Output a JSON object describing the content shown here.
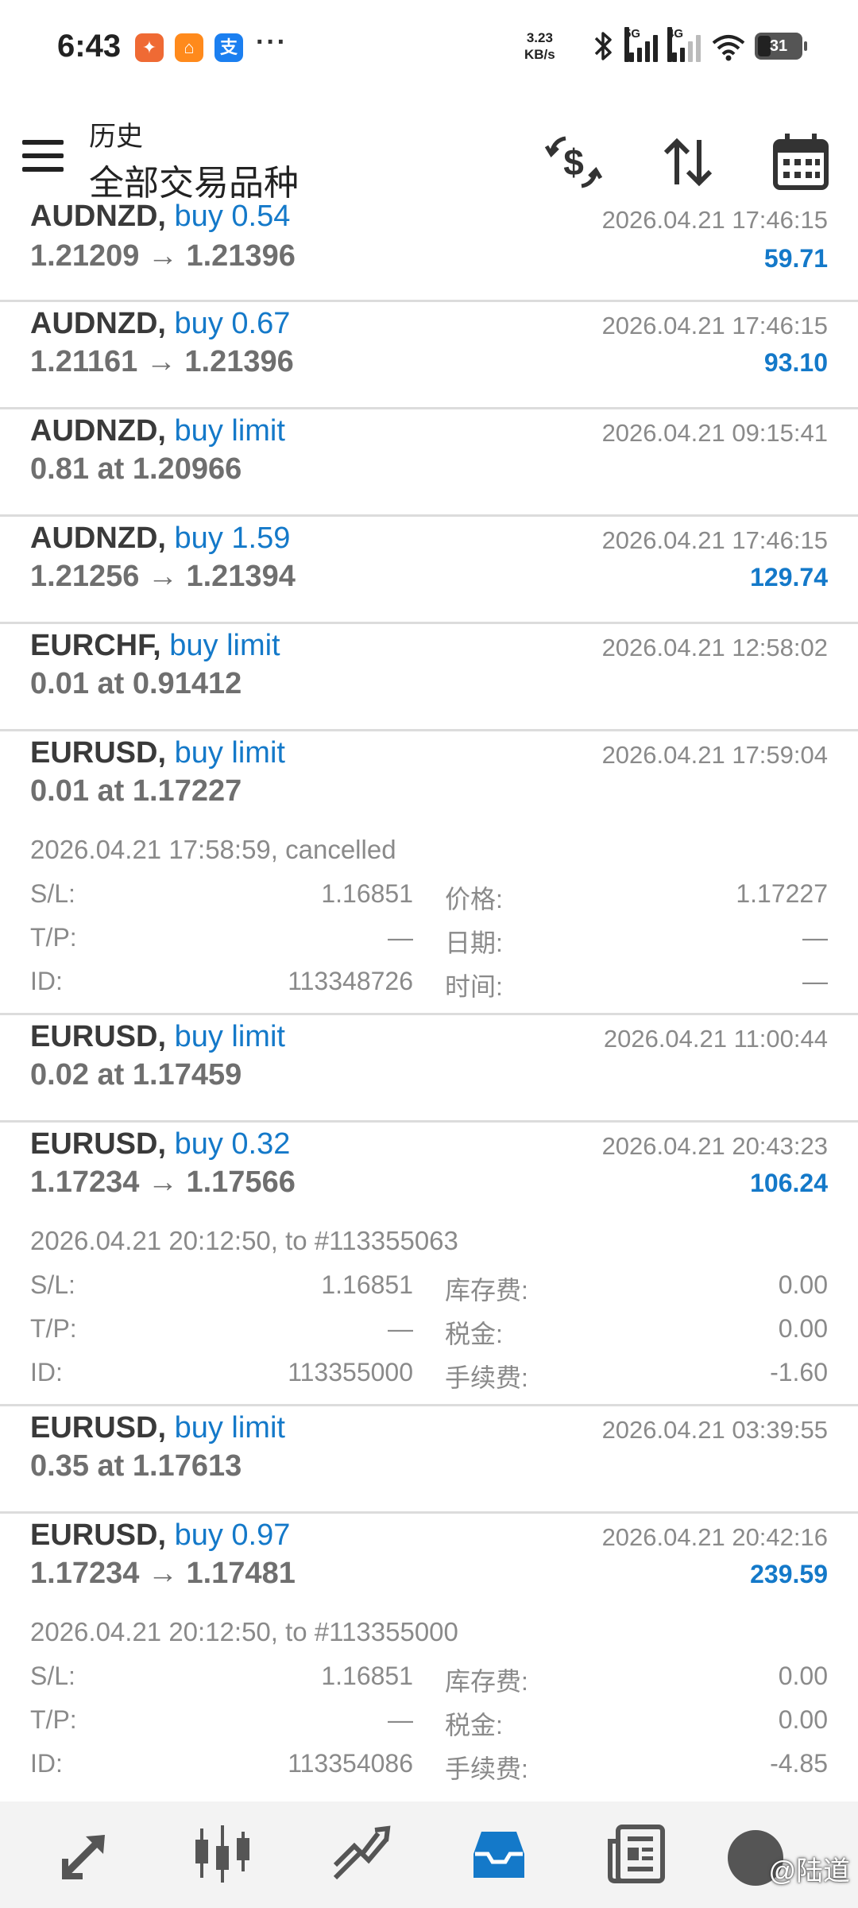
{
  "status_bar": {
    "time": "6:43",
    "dots": "···",
    "net_speed_value": "3.23",
    "net_speed_unit": "KB/s",
    "signal1_label": "5G",
    "signal2_label": "4G",
    "battery": "31"
  },
  "header": {
    "subtitle": "历史",
    "title": "全部交易品种"
  },
  "labels": {
    "sl": "S/L:",
    "tp": "T/P:",
    "id": "ID:",
    "price": "价格:",
    "date": "日期:",
    "time": "时间:",
    "swap": "库存费:",
    "tax": "税金:",
    "commission": "手续费:"
  },
  "records": [
    {
      "symbol": "AUDNZD,",
      "action": "buy 0.54",
      "line2": "1.21209 → 1.21396",
      "time": "2026.04.21 17:46:15",
      "profit": "59.71"
    },
    {
      "symbol": "AUDNZD,",
      "action": "buy 0.67",
      "line2": "1.21161 → 1.21396",
      "time": "2026.04.21 17:46:15",
      "profit": "93.10"
    },
    {
      "symbol": "AUDNZD,",
      "action": "buy limit",
      "line2": "0.81 at 1.20966",
      "time": "2026.04.21 09:15:41",
      "profit": ""
    },
    {
      "symbol": "AUDNZD,",
      "action": "buy 1.59",
      "line2": "1.21256 → 1.21394",
      "time": "2026.04.21 17:46:15",
      "profit": "129.74"
    },
    {
      "symbol": "EURCHF,",
      "action": "buy limit",
      "line2": "0.01 at 0.91412",
      "time": "2026.04.21 12:58:02",
      "profit": ""
    },
    {
      "symbol": "EURUSD,",
      "action": "buy limit",
      "line2": "0.01 at 1.17227",
      "time": "2026.04.21 17:59:04",
      "profit": "",
      "detail": "2026.04.21 17:58:59, cancelled",
      "sl": "1.16851",
      "tp": "—",
      "id": "113348726",
      "v_price": "1.17227",
      "v_date": "—",
      "v_time": "—"
    },
    {
      "symbol": "EURUSD,",
      "action": "buy limit",
      "line2": "0.02 at 1.17459",
      "time": "2026.04.21 11:00:44",
      "profit": ""
    },
    {
      "symbol": "EURUSD,",
      "action": "buy 0.32",
      "line2": "1.17234 → 1.17566",
      "time": "2026.04.21 20:43:23",
      "profit": "106.24",
      "detail": "2026.04.21 20:12:50, to #113355063",
      "sl": "1.16851",
      "tp": "—",
      "id": "113355000",
      "swap": "0.00",
      "tax": "0.00",
      "commission": "-1.60"
    },
    {
      "symbol": "EURUSD,",
      "action": "buy limit",
      "line2": "0.35 at 1.17613",
      "time": "2026.04.21 03:39:55",
      "profit": ""
    },
    {
      "symbol": "EURUSD,",
      "action": "buy 0.97",
      "line2": "1.17234 → 1.17481",
      "time": "2026.04.21 20:42:16",
      "profit": "239.59",
      "detail": "2026.04.21 20:12:50, to #113355000",
      "sl": "1.16851",
      "tp": "—",
      "id": "113354086",
      "swap": "0.00",
      "tax": "0.00",
      "commission": "-4.85"
    }
  ],
  "watermark": "@陆道",
  "colors": {
    "accent": "#1479c9",
    "symbol_text": "#3a3a3a",
    "muted_text": "#8a8a8a",
    "divider": "#dcdcdc",
    "nav_active": "#1479c9"
  },
  "icons": {
    "menu": "menu-icon",
    "currency": "currency-swap-icon",
    "sort": "sort-icon",
    "calendar": "calendar-icon",
    "nav": [
      "trade-quotes-icon",
      "chart-candles-icon",
      "trade-lines-icon",
      "history-inbox-icon",
      "news-icon",
      "messages-avatar-icon"
    ]
  }
}
